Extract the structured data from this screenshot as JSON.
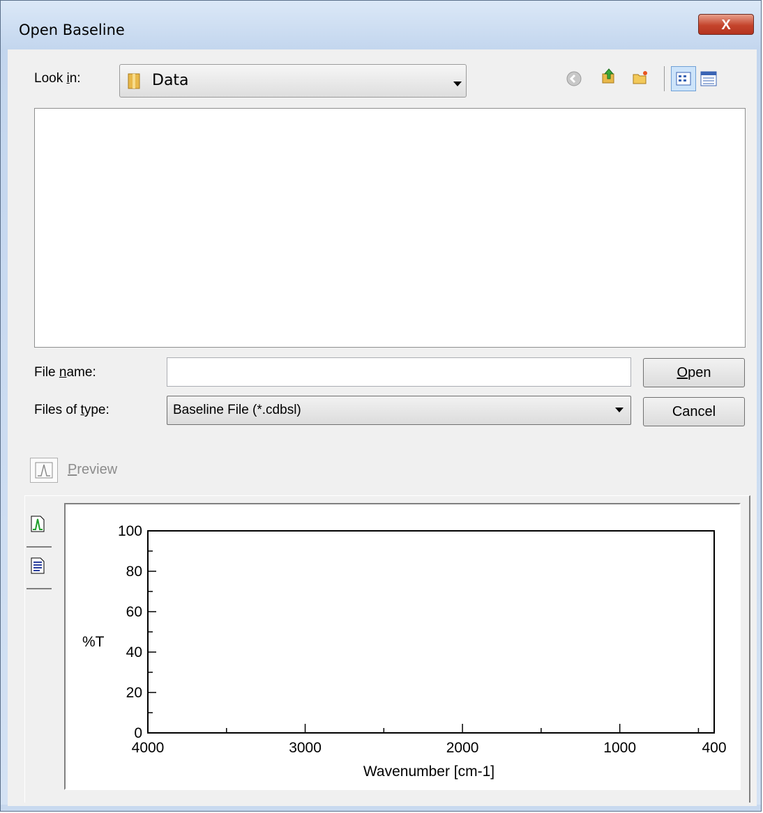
{
  "window": {
    "title": "Open Baseline",
    "close_glyph": "X"
  },
  "look_in": {
    "label_pre": "Look ",
    "label_mn": "i",
    "label_post": "n:",
    "folder": "Data",
    "folder_icon": "folder-icon"
  },
  "toolbar": {
    "icons": [
      "back-icon",
      "up-folder-icon",
      "new-folder-icon",
      "list-view-icon",
      "details-view-icon"
    ]
  },
  "file_name": {
    "label_pre": "File ",
    "label_mn": "n",
    "label_post": "ame:",
    "value": ""
  },
  "file_type": {
    "label_pre": "Files of ",
    "label_mn": "t",
    "label_post": "ype:",
    "value": "Baseline File (*.cdbsl)"
  },
  "buttons": {
    "open_mn": "O",
    "open_rest": "pen",
    "cancel": "Cancel"
  },
  "preview": {
    "label_mn": "P",
    "label_rest": "review",
    "checked": false
  },
  "preview_tabs": [
    "spectrum-tab-icon",
    "info-tab-icon"
  ],
  "colors": {
    "title_bar": "#c3d6ee",
    "close_button": "#c4442c",
    "selected_view": "#cde4fa"
  },
  "chart_data": {
    "type": "line",
    "title": "",
    "xlabel": "Wavenumber [cm-1]",
    "ylabel": "%T",
    "xlim": [
      4000,
      400
    ],
    "ylim": [
      0,
      100
    ],
    "x_ticks": [
      4000,
      3000,
      2000,
      1000,
      400
    ],
    "y_ticks": [
      0,
      20,
      40,
      60,
      80,
      100
    ],
    "x_minor_step": 500,
    "y_minor_step": 10,
    "grid": false,
    "series": []
  }
}
